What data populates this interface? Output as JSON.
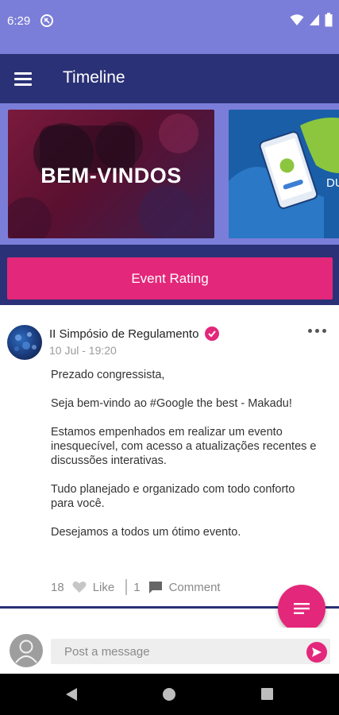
{
  "status_bar": {
    "time": "6:29",
    "icons": [
      "app-notification-icon",
      "wifi-icon",
      "signal-icon",
      "battery-icon"
    ]
  },
  "app_bar": {
    "title": "Timeline",
    "menu_icon": "hamburger-menu-icon"
  },
  "banners": [
    {
      "title": "BEM-VINDOS"
    },
    {
      "title": "DU"
    }
  ],
  "event_rating": {
    "label": "Event Rating"
  },
  "post": {
    "author": "II Simpósio de Regulamento",
    "timestamp": "10 Jul - 19:20",
    "paragraphs": [
      "Prezado congressista,",
      "Seja bem-vindo ao #Google the best - Makadu!",
      "Estamos empenhados em realizar um evento inesquecível, com acesso a atualizações recentes e discussões interativas.",
      "Tudo planejado e organizado com todo conforto para você.",
      "Desejamos a todos um ótimo evento."
    ],
    "like_count": "18",
    "like_label": "Like",
    "comment_count": "1",
    "comment_label": "Comment"
  },
  "composer": {
    "placeholder": "Post a message"
  },
  "colors": {
    "accent": "#e3277a",
    "primary_dark": "#2b3176",
    "primary_light": "#7b7ed8"
  }
}
